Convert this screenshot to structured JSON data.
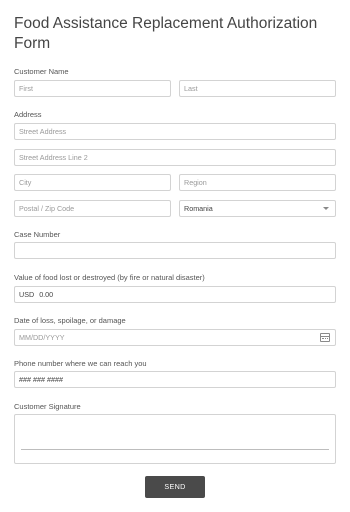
{
  "form": {
    "title": "Food Assistance Replacement Authorization Form",
    "customer_name": {
      "label": "Customer Name",
      "first_placeholder": "First",
      "last_placeholder": "Last"
    },
    "address": {
      "label": "Address",
      "street_placeholder": "Street Address",
      "street2_placeholder": "Street Address Line 2",
      "city_placeholder": "City",
      "region_placeholder": "Region",
      "postal_placeholder": "Postal / Zip Code",
      "country_value": "Romania"
    },
    "case_number": {
      "label": "Case Number",
      "value": ""
    },
    "food_value": {
      "label": "Value of food lost or destroyed (by fire or natural disaster)",
      "currency": "USD",
      "value": "0.00"
    },
    "date_of_loss": {
      "label": "Date of loss, spoilage, or damage",
      "placeholder": "MM/DD/YYYY",
      "icon": "calendar-icon"
    },
    "phone": {
      "label": "Phone number where we can reach you",
      "placeholder": "### ### ####"
    },
    "signature": {
      "label": "Customer Signature"
    },
    "submit_label": "SEND"
  }
}
